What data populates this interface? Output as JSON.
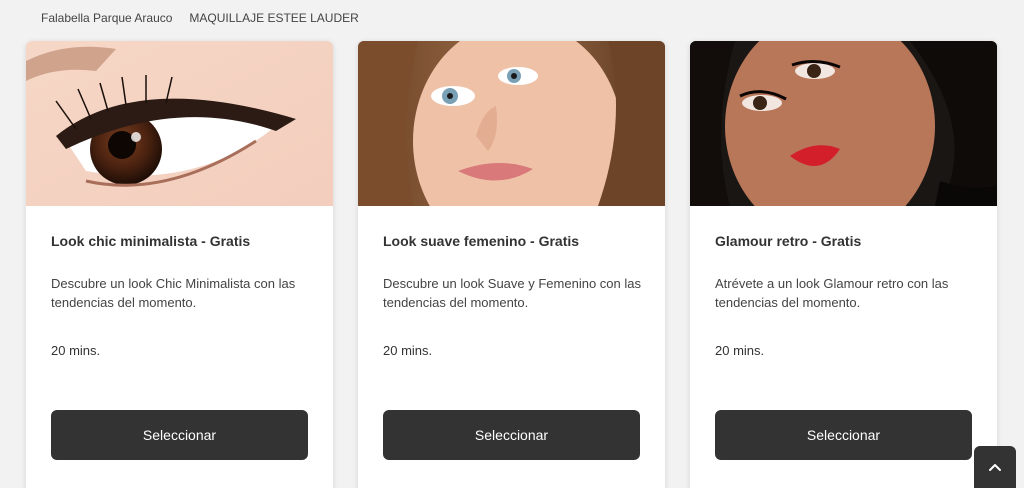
{
  "breadcrumb": {
    "store": "Falabella Parque Arauco",
    "category": "MAQUILLAJE ESTEE LAUDER"
  },
  "cards": [
    {
      "title": "Look chic minimalista - Gratis",
      "description": "Descubre un look Chic Minimalista con las tendencias del momento.",
      "duration": "20 mins.",
      "button": "Seleccionar"
    },
    {
      "title": "Look suave femenino - Gratis",
      "description": "Descubre un look Suave y Femenino con las tendencias del momento.",
      "duration": "20 mins.",
      "button": "Seleccionar"
    },
    {
      "title": "Glamour retro - Gratis",
      "description": "Atrévete a un look Glamour retro con las tendencias del momento.",
      "duration": "20 mins.",
      "button": "Seleccionar"
    }
  ],
  "back_to_top": {
    "icon": "chevron-up-icon"
  },
  "colors": {
    "background": "#f2f2f2",
    "button": "#333333",
    "button_text": "#ffffff"
  }
}
